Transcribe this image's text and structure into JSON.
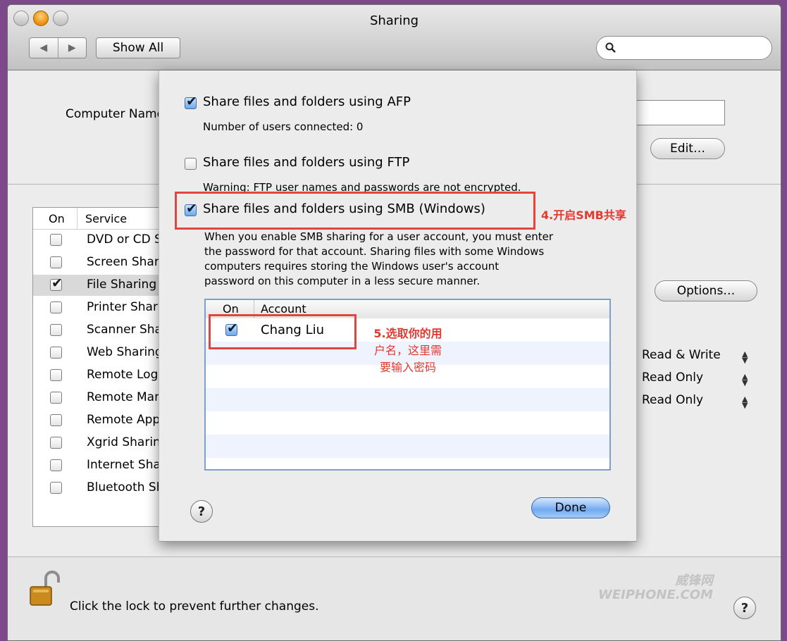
{
  "window": {
    "title": "Sharing"
  },
  "toolbar": {
    "back": "◀",
    "forward": "▶",
    "show_all": "Show All",
    "search_icon": "search-icon"
  },
  "computer": {
    "name_label": "Computer Name:",
    "edit_label": "Edit…"
  },
  "services": {
    "col_on": "On",
    "col_service": "Service",
    "items": [
      {
        "label": "DVD or CD Sharing",
        "on": false
      },
      {
        "label": "Screen Sharing",
        "on": false
      },
      {
        "label": "File Sharing",
        "on": true
      },
      {
        "label": "Printer Sharing",
        "on": false
      },
      {
        "label": "Scanner Sharing",
        "on": false
      },
      {
        "label": "Web Sharing",
        "on": false
      },
      {
        "label": "Remote Login",
        "on": false
      },
      {
        "label": "Remote Management",
        "on": false
      },
      {
        "label": "Remote Apple Events",
        "on": false
      },
      {
        "label": "Xgrid Sharing",
        "on": false
      },
      {
        "label": "Internet Sharing",
        "on": false
      },
      {
        "label": "Bluetooth Sharing",
        "on": false
      }
    ]
  },
  "options_label": "Options…",
  "permissions": [
    "Read & Write",
    "Read Only",
    "Read Only"
  ],
  "sheet": {
    "afp": {
      "label": "Share files and folders using AFP",
      "checked": true,
      "note": "Number of users connected: 0"
    },
    "ftp": {
      "label": "Share files and folders using FTP",
      "checked": false,
      "note": "Warning: FTP user names and passwords are not encrypted."
    },
    "smb": {
      "label": "Share files and folders using SMB (Windows)",
      "checked": true,
      "desc_lines": [
        "When you enable SMB sharing for a user account, you must enter",
        "the password for that account. Sharing files with some Windows",
        "computers requires storing the Windows user's account",
        "password on this computer in a less secure manner."
      ]
    },
    "accounts": {
      "col_on": "On",
      "col_account": "Account",
      "items": [
        {
          "name": "Chang Liu",
          "on": true
        }
      ]
    },
    "help": "?",
    "done": "Done"
  },
  "annotations": {
    "smb": "4.开启SMB共享",
    "account_lines": [
      "5.选取你的用",
      "户名，这里需",
      "要输入密码"
    ]
  },
  "footer": {
    "lock_text": "Click the lock to prevent further changes.",
    "help": "?"
  },
  "watermark": {
    "line1": "威锋网",
    "line2": "WEIPHONE.COM"
  }
}
